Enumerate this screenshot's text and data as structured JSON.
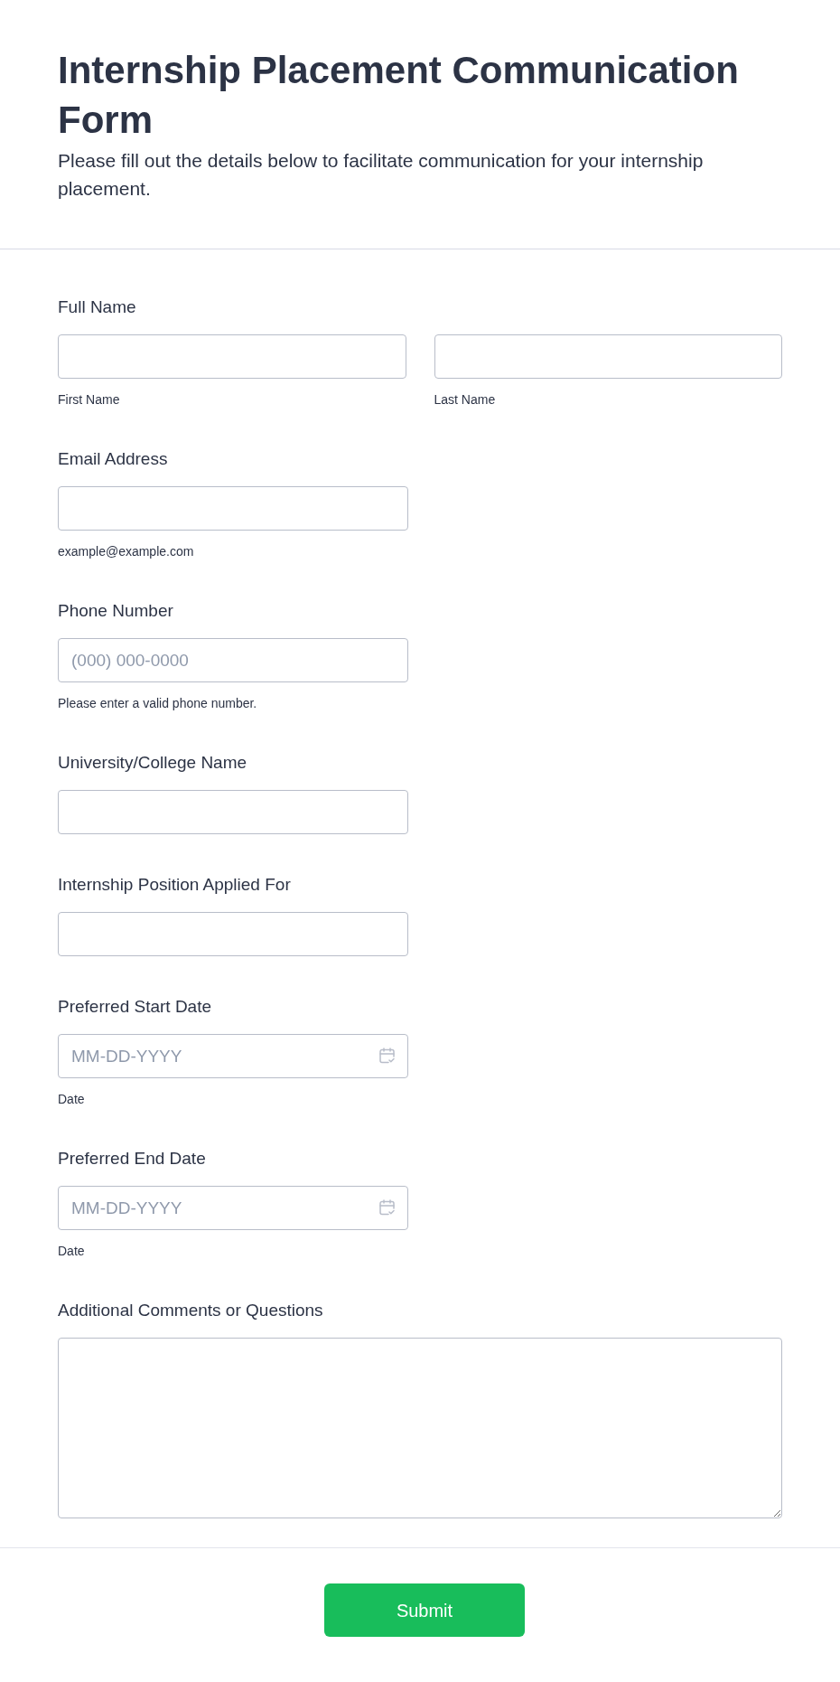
{
  "header": {
    "title": "Internship Placement Communication Form",
    "description": "Please fill out the details below to facilitate communication for your internship placement."
  },
  "fields": [
    {
      "kind": "name",
      "label": "Full Name",
      "parts": [
        {
          "sublabel": "First Name"
        },
        {
          "sublabel": "Last Name"
        }
      ]
    },
    {
      "kind": "text",
      "label": "Email Address",
      "sublabel": "example@example.com"
    },
    {
      "kind": "text",
      "label": "Phone Number",
      "placeholder": "(000) 000-0000",
      "sublabel": "Please enter a valid phone number."
    },
    {
      "kind": "text",
      "label": "University/College Name"
    },
    {
      "kind": "text",
      "label": "Internship Position Applied For"
    },
    {
      "kind": "date",
      "label": "Preferred Start Date",
      "placeholder": "MM-DD-YYYY",
      "sublabel": "Date"
    },
    {
      "kind": "date",
      "label": "Preferred End Date",
      "placeholder": "MM-DD-YYYY",
      "sublabel": "Date"
    },
    {
      "kind": "textarea",
      "label": "Additional Comments or Questions"
    }
  ],
  "submit_button": {
    "label": "Submit"
  }
}
